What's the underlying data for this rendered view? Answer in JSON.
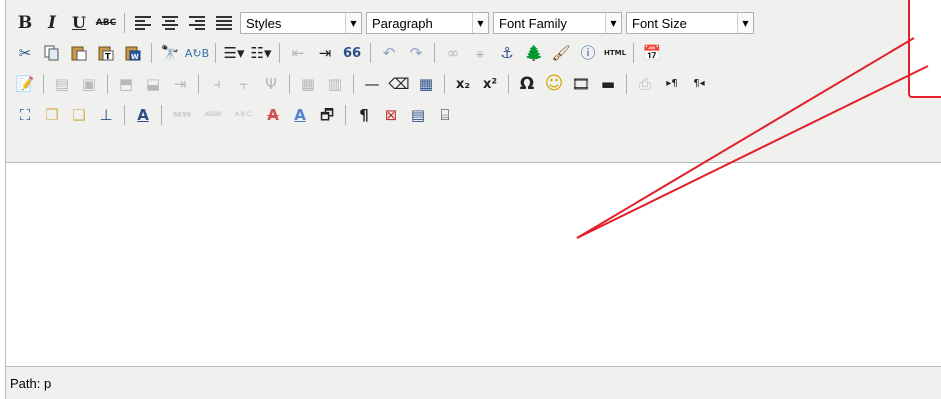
{
  "toolbar": {
    "row1": {
      "bold_label": "B",
      "italic_label": "I",
      "underline_label": "U",
      "strike_label": "ABC",
      "styles_select": "Styles",
      "format_select": "Paragraph",
      "fontfamily_select": "Font Family",
      "fontsize_select": "Font Size"
    },
    "row2": {
      "html_label": "HTML",
      "quote_label": "66"
    },
    "row3": {
      "subscript_label": "x₂",
      "superscript_label": "x²",
      "omega_label": "Ω"
    },
    "row4": {
      "cite_label": "6699",
      "abbr_label": "ABBR",
      "acronym_label": "A.B.C.",
      "pilcrow_label": "¶"
    }
  },
  "statusbar": {
    "path_text": "Path: p"
  },
  "annotation": {
    "color": "#e0202a"
  }
}
